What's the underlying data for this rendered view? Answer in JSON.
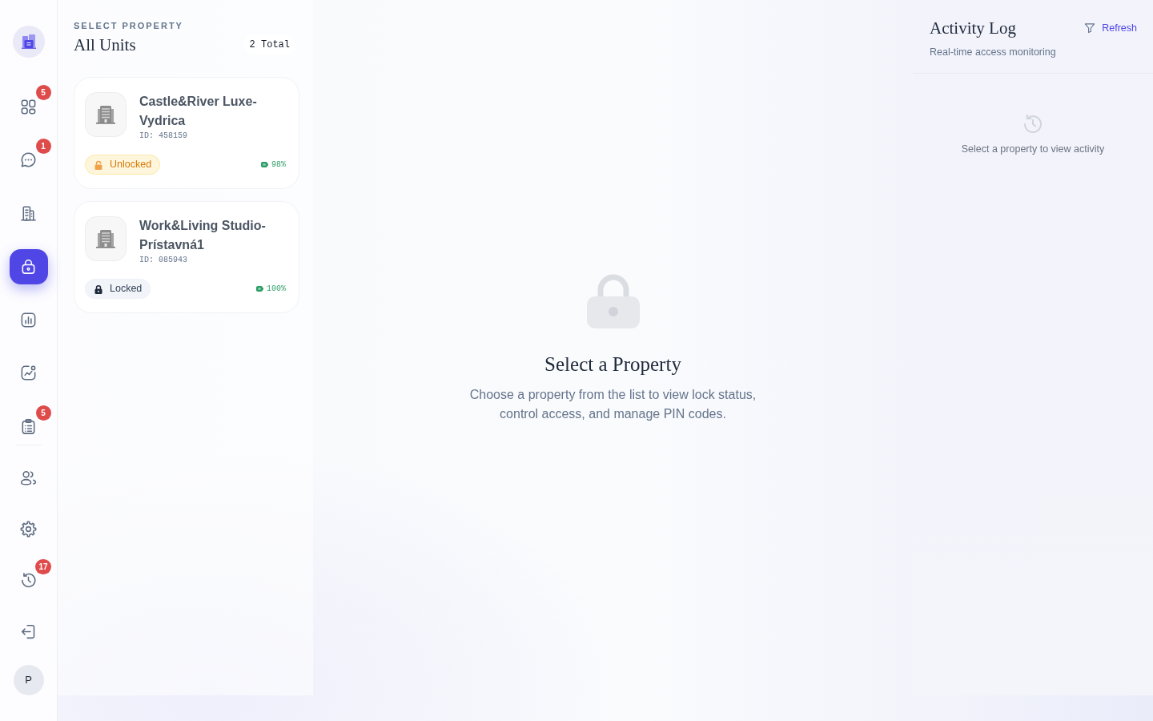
{
  "sidebar": {
    "nav_groups": [
      {
        "items": [
          {
            "badge": "5",
            "selected": false
          },
          {
            "badge": "1",
            "selected": false
          },
          {
            "selected": false
          },
          {
            "selected": true
          },
          {
            "selected": false
          },
          {
            "selected": false
          },
          {
            "badge": "5",
            "selected": false
          }
        ]
      },
      {
        "items": [
          {
            "selected": false
          },
          {
            "selected": false
          },
          {
            "badge": "17",
            "selected": false
          },
          {
            "selected": false
          }
        ]
      }
    ],
    "avatar": "P"
  },
  "property_list": {
    "eyebrow": "SELECT PROPERTY",
    "title": "All Units",
    "count": "2 Total",
    "properties": [
      {
        "name": "Castle&River Luxe-Vydrica",
        "id": "ID: 458159",
        "selected": false,
        "locked": false,
        "lock_label": "Unlocked",
        "battery": "98%"
      },
      {
        "name": "Work&Living Studio-Prístavná1",
        "id": "ID: 085943",
        "selected": false,
        "locked": true,
        "lock_label": "Locked",
        "battery": "100%"
      }
    ]
  },
  "empty_state": {
    "title": "Select a Property",
    "description": "Choose a property from the list to view lock status, control access, and manage PIN codes."
  },
  "activity_log": {
    "title": "Activity Log",
    "refresh": "Refresh",
    "subtitle": "Real-time access monitoring",
    "empty_message": "Select a property to view activity"
  }
}
